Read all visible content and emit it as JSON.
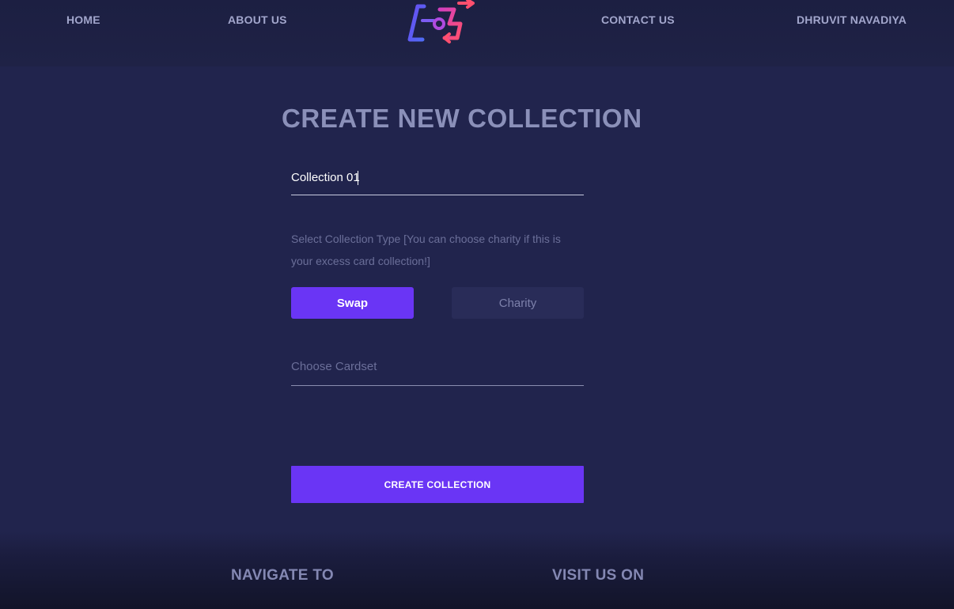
{
  "header": {
    "nav": {
      "home": "HOME",
      "about": "ABOUT US",
      "contact": "CONTACT US",
      "user": "DHRUVIT NAVADIYA"
    },
    "logo_icon": "swap-arrows-logo-icon"
  },
  "main": {
    "title": "CREATE NEW COLLECTION",
    "collection_name_value": "Collection 01",
    "type_label": "Select Collection Type [You can choose charity if this is your excess card collection!]",
    "type_options": {
      "swap": "Swap",
      "charity": "Charity"
    },
    "selected_type": "Swap",
    "cardset_placeholder": "Choose Cardset",
    "create_button": "CREATE COLLECTION"
  },
  "footer": {
    "navigate_to": "NAVIGATE TO",
    "visit_us_on": "VISIT US ON"
  },
  "colors": {
    "background": "#21244d",
    "accent": "#6a35f5",
    "muted_text": "#6b6f99",
    "nav_text": "#a2a6cc"
  }
}
